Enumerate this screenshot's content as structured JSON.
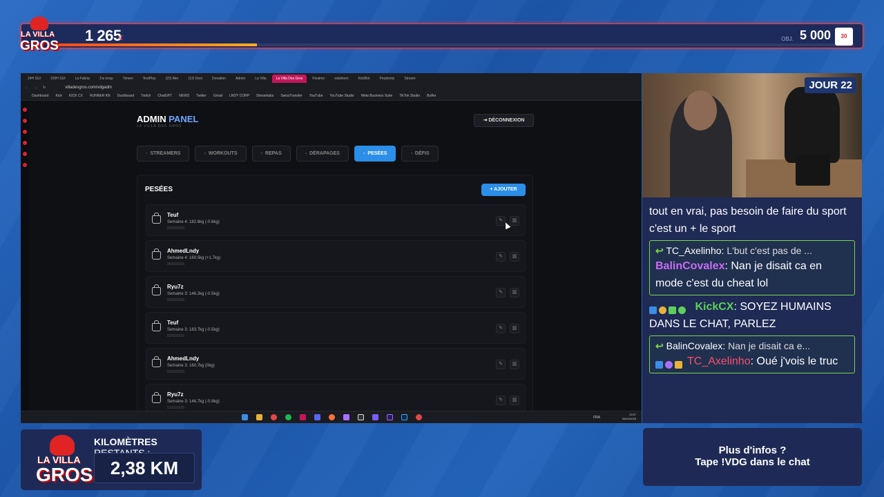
{
  "overlay": {
    "counter": "1 265",
    "counter_unit": "€",
    "goal_label": "OBJ.",
    "goal": "5 000",
    "goal_unit": "€",
    "progress": 0.253,
    "logo_top": "LA VILLA",
    "logo_bottom": "GROS",
    "badge": "30"
  },
  "browser": {
    "tabs": [
      "24H SUI",
      "100H SUI",
      "La Fabriq",
      "J'ai enqu",
      "Timers",
      "TextPlay",
      "(22) Aler",
      "(13) Dest",
      "Donation",
      "Admin",
      "La Villa",
      "La Villa Des Gros",
      "Finalmo",
      "edulinem",
      "KickBot",
      "Perplexity",
      "Stream"
    ],
    "url": "villadesgros.com/vdgadm",
    "bookmarks": [
      "Dashboard",
      "Kick",
      "KICK CX",
      "RUNNER KN",
      "Dashboard",
      "Twitch",
      "ChatGPT",
      "NEWS",
      "Twitter",
      "Gmail",
      "LNDY CORP",
      "Streamlabs",
      "SwissTransfer",
      "YouTube",
      "YouTube Studio",
      "Meta Business Suite",
      "TikTok Studio",
      "Buffer"
    ],
    "tray_lang": "FRA",
    "tray_time": "13:57",
    "tray_date": "06/02/2026"
  },
  "admin": {
    "title_a": "ADMIN",
    "title_b": " PANEL",
    "subtitle": "LA VILLA DES GROS",
    "logout": "DÉCONNEXION",
    "tabs": [
      "STREAMERS",
      "WORKOUTS",
      "REPAS",
      "DÉRAPAGES",
      "PESÉES",
      "DÉFIS"
    ],
    "active_tab": "PESÉES",
    "panel_title": "PESÉES",
    "add_button": "+ AJOUTER",
    "rows": [
      {
        "name": "Teuf",
        "detail": "Semaine 4: 182.6kg (-0.6kg)",
        "date": "05/02/2026"
      },
      {
        "name": "AhmedLndy",
        "detail": "Semaine 4: 160.5kg (+1.7kg)",
        "date": "05/02/2026"
      },
      {
        "name": "Ryu7z",
        "detail": "Semaine 3: 146.2kg (-0.5kg)",
        "date": "02/02/2026"
      },
      {
        "name": "Teuf",
        "detail": "Semaine 3: 183.7kg (-0.5kg)",
        "date": "02/02/2026"
      },
      {
        "name": "AhmedLndy",
        "detail": "Semaine 3: 160.7kg (0kg)",
        "date": "02/02/2026"
      },
      {
        "name": "Ryu7z",
        "detail": "Semaine 3: 146.7kg (-0.9kg)",
        "date": "01/02/2026"
      }
    ]
  },
  "cam": {
    "day_label": "JOUR 22"
  },
  "chat": {
    "line1": "tout en vrai, pas besoin de faire du sport c'est un + le sport",
    "reply1_ref_user": "TC_Axelinho:",
    "reply1_ref_text": "L'but c'est pas de ...",
    "reply1_user": "BalinCovalex",
    "reply1_text": ": Nan je disait ca en mode c'est du cheat lol",
    "msg2_user": "KickCX",
    "msg2_text": ": SOYEZ HUMAINS DANS LE CHAT, PARLEZ",
    "reply2_ref_user": "BalinCovalex:",
    "reply2_ref_text": "Nan je disait ca e...",
    "reply2_user": "TC_Axelinho",
    "reply2_text": ": Oué j'vois le truc"
  },
  "km": {
    "label_bold": "KILOMÈTRES",
    "label_rest": " RESTANTS :",
    "value": "2,38 KM"
  },
  "info": {
    "line1": "Plus d'infos ?",
    "line2": "Tape !VDG dans le chat"
  }
}
